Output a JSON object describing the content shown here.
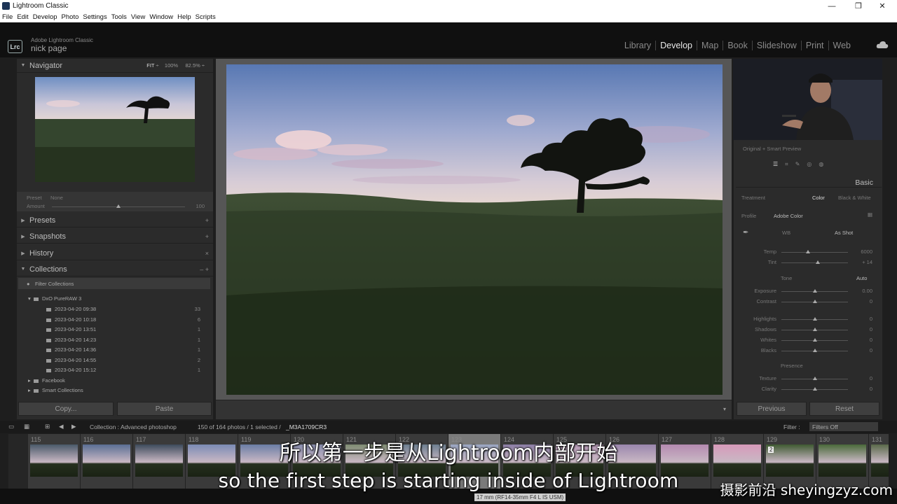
{
  "window": {
    "title": "Lightroom Classic",
    "min": "—",
    "max": "❐",
    "close": "✕"
  },
  "menu": [
    "File",
    "Edit",
    "Develop",
    "Photo",
    "Settings",
    "Tools",
    "View",
    "Window",
    "Help",
    "Scripts"
  ],
  "identity": {
    "badge": "Lrc",
    "product": "Adobe Lightroom Classic",
    "user": "nick page"
  },
  "modules": [
    "Library",
    "Develop",
    "Map",
    "Book",
    "Slideshow",
    "Print",
    "Web"
  ],
  "active_module": "Develop",
  "navigator": {
    "title": "Navigator",
    "fit": "FIT",
    "z100": "100%",
    "z825": "82.5%"
  },
  "preset_amount": {
    "label1": "Preset",
    "label2": "None",
    "label3": "Amount",
    "value": "100"
  },
  "left_sections": {
    "presets": "Presets",
    "snapshots": "Snapshots",
    "history": "History",
    "collections": "Collections"
  },
  "collections": {
    "filter": "Filter Collections",
    "group": "DxO PureRAW 3",
    "items": [
      {
        "name": "2023-04-20 09:38",
        "count": "33"
      },
      {
        "name": "2023-04-20 10:18",
        "count": "6"
      },
      {
        "name": "2023-04-20 13:51",
        "count": "1"
      },
      {
        "name": "2023-04-20 14:23",
        "count": "1"
      },
      {
        "name": "2023-04-20 14:36",
        "count": "1"
      },
      {
        "name": "2023-04-20 14:55",
        "count": "2"
      },
      {
        "name": "2023-04-20 15:12",
        "count": "1"
      }
    ],
    "facebook": "Facebook",
    "smart": "Smart Collections"
  },
  "left_buttons": {
    "copy": "Copy...",
    "paste": "Paste"
  },
  "right_panel": {
    "preview_mode": "Original + Smart Preview",
    "basic": "Basic",
    "treatment": "Treatment",
    "color": "Color",
    "bw": "Black & White",
    "profile": "Profile",
    "profile_value": "Adobe Color",
    "wb": "WB",
    "wb_value": "As Shot",
    "tone": "Tone",
    "auto": "Auto",
    "presence": "Presence",
    "sliders": [
      {
        "label": "Temp",
        "value": "6000",
        "pos": 0.4
      },
      {
        "label": "Tint",
        "value": "+ 14",
        "pos": 0.55
      },
      {
        "label": "Exposure",
        "value": "0.00",
        "pos": 0.5
      },
      {
        "label": "Contrast",
        "value": "0",
        "pos": 0.5
      },
      {
        "label": "Highlights",
        "value": "0",
        "pos": 0.5
      },
      {
        "label": "Shadows",
        "value": "0",
        "pos": 0.5
      },
      {
        "label": "Whites",
        "value": "0",
        "pos": 0.5
      },
      {
        "label": "Blacks",
        "value": "0",
        "pos": 0.5
      },
      {
        "label": "Texture",
        "value": "0",
        "pos": 0.5
      },
      {
        "label": "Clarity",
        "value": "0",
        "pos": 0.5
      }
    ],
    "previous": "Previous",
    "reset": "Reset"
  },
  "strip_bar": {
    "collection": "Collection : Advanced photoshop",
    "count": "150 of 164 photos / 1 selected /",
    "file": "_M3A1709CR3",
    "filter_label": "Filter :",
    "filter_value": "Filters Off"
  },
  "thumbs": [
    "115",
    "116",
    "117",
    "118",
    "119",
    "120",
    "121",
    "122",
    "123",
    "124",
    "125",
    "126",
    "127",
    "128",
    "129",
    "130",
    "131"
  ],
  "badge_2": "2",
  "lens_tooltip": "17 mm (RF14-35mm F4 L IS USM)",
  "subtitles": {
    "cn": "所以第一步是从Lightroom内部开始",
    "en": "so the first step is starting inside of Lightroom"
  },
  "watermark": "摄影前沿 sheyingzyz.com",
  "colors": {
    "accent": "#e8e8e8",
    "panel": "#2b2b2b",
    "background": "#1e1e1e"
  }
}
